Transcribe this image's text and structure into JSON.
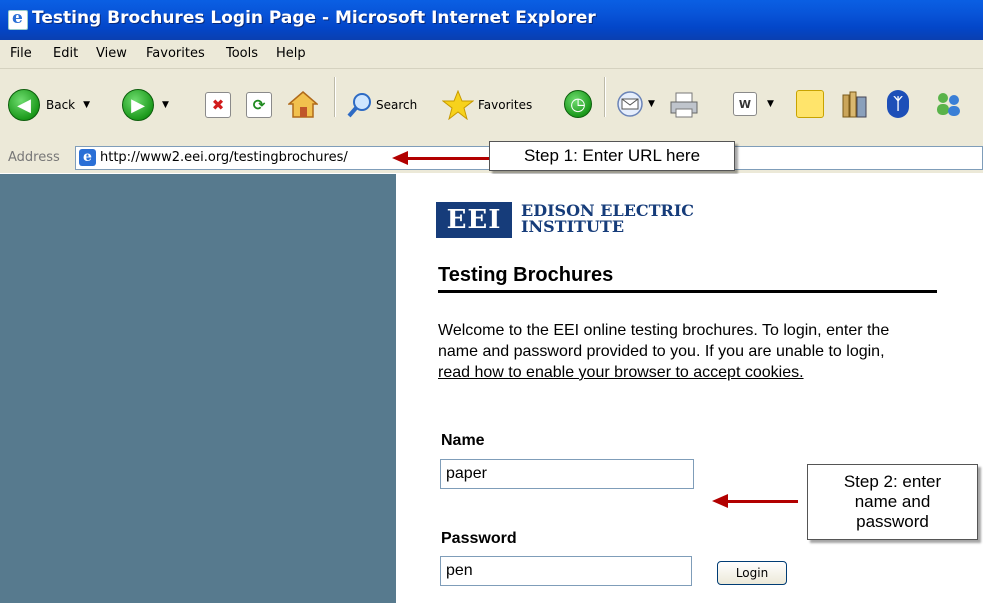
{
  "window": {
    "title": "Testing Brochures Login Page - Microsoft Internet Explorer"
  },
  "menu": [
    "File",
    "Edit",
    "View",
    "Favorites",
    "Tools",
    "Help"
  ],
  "toolbar": {
    "back_label": "Back",
    "search_label": "Search",
    "favorites_label": "Favorites"
  },
  "address": {
    "label": "Address",
    "url": "http://www2.eei.org/testingbrochures/"
  },
  "callouts": {
    "step1": "Step 1: Enter URL here",
    "step2": "Step 2: enter name and password"
  },
  "page": {
    "logo_mark": "EEI",
    "logo_line1": "EDISON ELECTRIC",
    "logo_line2": "INSTITUTE",
    "heading": "Testing Brochures",
    "welcome_text": "Welcome to the EEI online testing brochures. To login, enter the name and password provided to you. If you are unable to login, ",
    "welcome_link": "read how to enable your browser to accept cookies.",
    "name_label": "Name",
    "name_value": "paper",
    "password_label": "Password",
    "password_value": "pen",
    "login_button": "Login"
  },
  "colors": {
    "sidebar": "#577a8e",
    "arrow": "#b20000",
    "logo": "#163c7a"
  }
}
